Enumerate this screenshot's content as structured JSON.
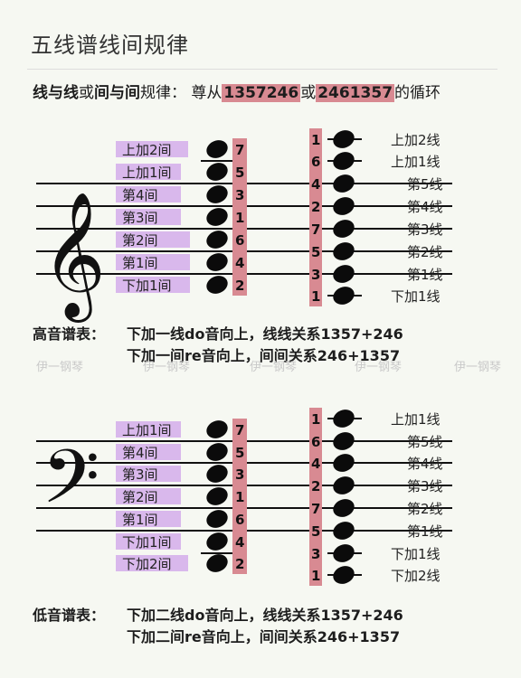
{
  "title": "五线谱线间规律",
  "rule": {
    "prefix_bold1": "线与线",
    "mid1": "或",
    "prefix_bold2": "间与间",
    "mid2": "规律：  尊从",
    "seq1": "1357246",
    "mid3": "或",
    "seq2": "2461357",
    "suffix": "的循环"
  },
  "treble": {
    "space_labels": [
      "上加2间",
      "上加1间",
      "第4间",
      "第3间",
      "第2间",
      "第1间",
      "下加1间"
    ],
    "space_numbers": [
      "7",
      "5",
      "3",
      "1",
      "6",
      "4",
      "2"
    ],
    "line_numbers": [
      "1",
      "6",
      "4",
      "2",
      "7",
      "5",
      "3",
      "1"
    ],
    "line_labels": [
      "上加2线",
      "上加1线",
      "第5线",
      "第4线",
      "第3线",
      "第2线",
      "第1线",
      "下加1线"
    ],
    "desc_label": "高音谱表：",
    "desc_line1": "下加一线do音向上，线线关系1357+246",
    "desc_line2": "下加一间re音向上，间间关系246+1357"
  },
  "bass": {
    "space_labels": [
      "上加1间",
      "第4间",
      "第3间",
      "第2间",
      "第1间",
      "下加1间",
      "下加2间"
    ],
    "space_numbers": [
      "7",
      "5",
      "3",
      "1",
      "6",
      "4",
      "2"
    ],
    "line_numbers": [
      "1",
      "6",
      "4",
      "2",
      "7",
      "5",
      "3",
      "1"
    ],
    "line_labels": [
      "上加1线",
      "第5线",
      "第4线",
      "第3线",
      "第2线",
      "第1线",
      "下加1线",
      "下加2线"
    ],
    "desc_label": "低音谱表：",
    "desc_line1": "下加二线do音向上，线线关系1357+246",
    "desc_line2": "下加二间re音向上，间间关系246+1357"
  },
  "watermarks": [
    "伊一钢琴",
    "伊一钢琴",
    "伊一钢琴",
    "伊一钢琴",
    "伊一钢琴"
  ],
  "colors": {
    "label_bg": "#d9b8ec",
    "number_bg": "#d88a92",
    "background": "#f6f8f2"
  }
}
